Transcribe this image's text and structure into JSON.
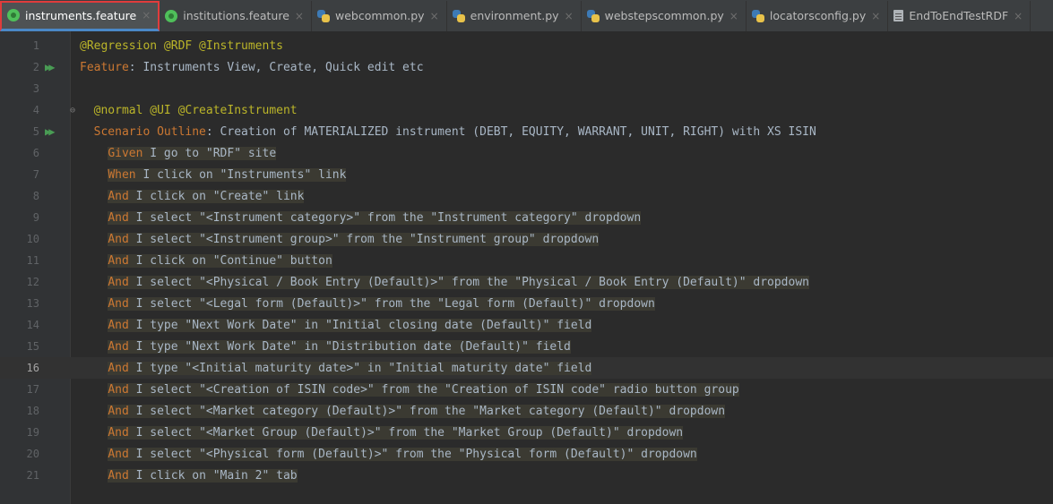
{
  "tabs": [
    {
      "label": "instruments.feature",
      "icon": "cucumber-icon",
      "active": true
    },
    {
      "label": "institutions.feature",
      "icon": "cucumber-icon",
      "active": false
    },
    {
      "label": "webcommon.py",
      "icon": "python-file-icon",
      "active": false
    },
    {
      "label": "environment.py",
      "icon": "python-file-icon",
      "active": false
    },
    {
      "label": "webstepscommon.py",
      "icon": "python-file-icon",
      "active": false
    },
    {
      "label": "locatorsconfig.py",
      "icon": "python-file-icon",
      "active": false
    },
    {
      "label": "EndToEndTestRDF",
      "icon": "text-file-icon",
      "active": false
    }
  ],
  "colors": {
    "editor_bg": "#2b2b2b",
    "keyword": "#cc7832",
    "tag": "#bbb529",
    "text": "#a9b7c6",
    "step_highlight": "#3b3a32",
    "active_tab_outline": "#e03c3c",
    "run_icon": "#499c54"
  },
  "current_line": 16,
  "lines": [
    {
      "num": "1",
      "indent": "",
      "kw": "",
      "text": "@Regression @RDF @Instruments",
      "type": "tag"
    },
    {
      "num": "2",
      "indent": "",
      "kw": "Feature",
      "text": ": Instruments View, Create, Quick edit etc",
      "type": "feature",
      "run": true
    },
    {
      "num": "3",
      "indent": "",
      "kw": "",
      "text": "",
      "type": "blank"
    },
    {
      "num": "4",
      "indent": "  ",
      "kw": "",
      "text": "@normal @UI @CreateInstrument",
      "type": "tag",
      "fold": true
    },
    {
      "num": "5",
      "indent": "  ",
      "kw": "Scenario Outline",
      "text": ": Creation of MATERIALIZED instrument (DEBT, EQUITY, WARRANT, UNIT, RIGHT) with XS ISIN",
      "type": "scenario",
      "run": true
    },
    {
      "num": "6",
      "indent": "    ",
      "kw": "Given",
      "text": " I go to \"RDF\" site",
      "type": "step"
    },
    {
      "num": "7",
      "indent": "    ",
      "kw": "When",
      "text": " I click on \"Instruments\" link",
      "type": "step"
    },
    {
      "num": "8",
      "indent": "    ",
      "kw": "And",
      "text": " I click on \"Create\" link",
      "type": "step"
    },
    {
      "num": "9",
      "indent": "    ",
      "kw": "And",
      "text": " I select \"<Instrument category>\" from the \"Instrument category\" dropdown",
      "type": "step"
    },
    {
      "num": "10",
      "indent": "    ",
      "kw": "And",
      "text": " I select \"<Instrument group>\" from the \"Instrument group\" dropdown",
      "type": "step"
    },
    {
      "num": "11",
      "indent": "    ",
      "kw": "And",
      "text": " I click on \"Continue\" button",
      "type": "step"
    },
    {
      "num": "12",
      "indent": "    ",
      "kw": "And",
      "text": " I select \"<Physical / Book Entry (Default)>\" from the \"Physical / Book Entry (Default)\" dropdown",
      "type": "step"
    },
    {
      "num": "13",
      "indent": "    ",
      "kw": "And",
      "text": " I select \"<Legal form (Default)>\" from the \"Legal form (Default)\" dropdown",
      "type": "step"
    },
    {
      "num": "14",
      "indent": "    ",
      "kw": "And",
      "text": " I type \"Next Work Date\" in \"Initial closing date (Default)\" field",
      "type": "step"
    },
    {
      "num": "15",
      "indent": "    ",
      "kw": "And",
      "text": " I type \"Next Work Date\" in \"Distribution date (Default)\" field",
      "type": "step"
    },
    {
      "num": "16",
      "indent": "    ",
      "kw": "And",
      "text": " I type \"<Initial maturity date>\" in \"Initial maturity date\" field",
      "type": "step"
    },
    {
      "num": "17",
      "indent": "    ",
      "kw": "And",
      "text": " I select \"<Creation of ISIN code>\" from the \"Creation of ISIN code\" radio button group",
      "type": "step"
    },
    {
      "num": "18",
      "indent": "    ",
      "kw": "And",
      "text": " I select \"<Market category (Default)>\" from the \"Market category (Default)\" dropdown",
      "type": "step"
    },
    {
      "num": "19",
      "indent": "    ",
      "kw": "And",
      "text": " I select \"<Market Group (Default)>\" from the \"Market Group (Default)\" dropdown",
      "type": "step"
    },
    {
      "num": "20",
      "indent": "    ",
      "kw": "And",
      "text": " I select \"<Physical form (Default)>\" from the \"Physical form (Default)\" dropdown",
      "type": "step"
    },
    {
      "num": "21",
      "indent": "    ",
      "kw": "And",
      "text": " I click on \"Main 2\" tab",
      "type": "step"
    }
  ]
}
